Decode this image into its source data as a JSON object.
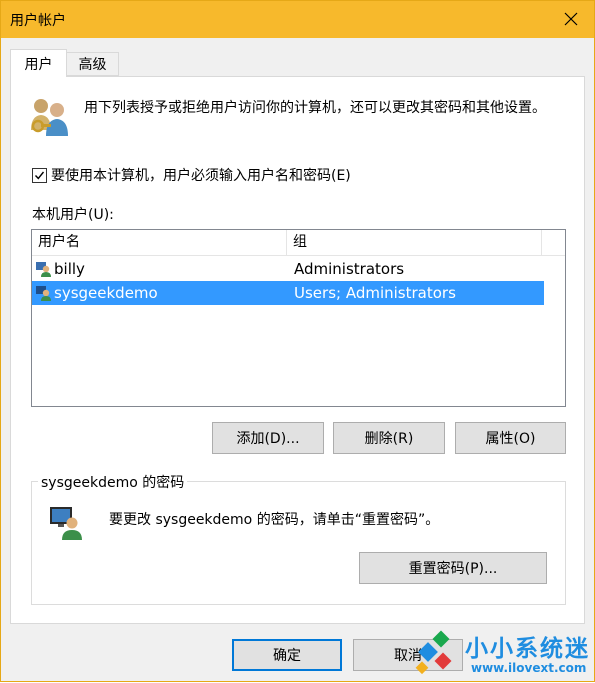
{
  "window": {
    "title": "用户帐户"
  },
  "tabs": [
    {
      "label": "用户"
    },
    {
      "label": "高级"
    }
  ],
  "description": "用下列表授予或拒绝用户访问你的计算机，还可以更改其密码和其他设置。",
  "require_login": {
    "label": "要使用本计算机，用户必须输入用户名和密码(E)",
    "checked": true
  },
  "local_users": {
    "label": "本机用户(U):",
    "columns": {
      "name": "用户名",
      "group": "组"
    },
    "rows": [
      {
        "name": "billy",
        "group": "Administrators",
        "selected": false
      },
      {
        "name": "sysgeekdemo",
        "group": "Users; Administrators",
        "selected": true
      }
    ]
  },
  "buttons": {
    "add": "添加(D)...",
    "remove": "删除(R)",
    "properties": "属性(O)"
  },
  "password_group": {
    "legend": "sysgeekdemo 的密码",
    "text": "要更改 sysgeekdemo 的密码，请单击“重置密码”。",
    "reset_button": "重置密码(P)..."
  },
  "footer": {
    "ok": "确定",
    "cancel": "取消"
  },
  "watermark": {
    "name": "小小系统迷",
    "url": "www.ilovext.com"
  },
  "colors": {
    "titlebar": "#f7b92c",
    "selection": "#3399ff",
    "ok_border": "#0078d7"
  }
}
